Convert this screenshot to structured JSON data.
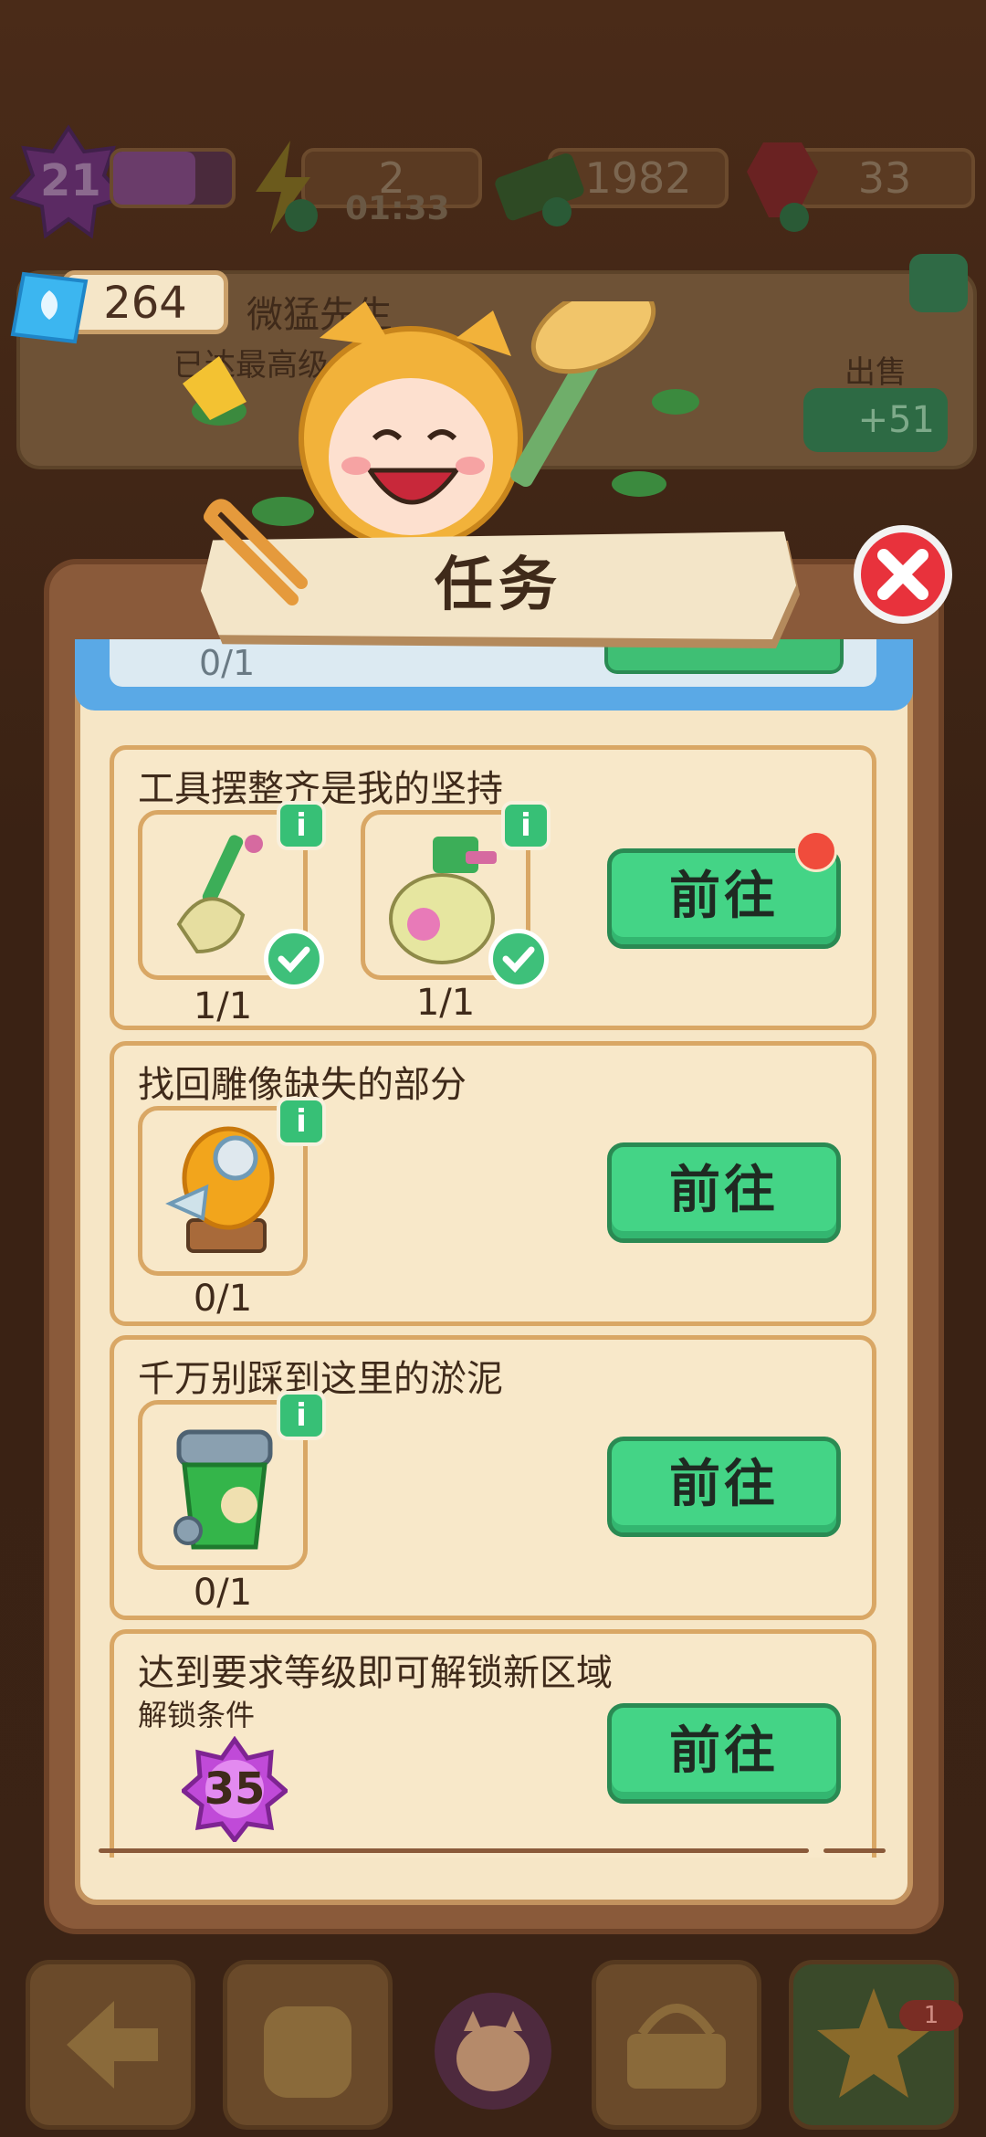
{
  "hud": {
    "level": "21",
    "energy": "2",
    "energy_timer": "01:33",
    "cash": "1982",
    "gems": "33",
    "tickets": "264"
  },
  "background_card": {
    "name": "微猛先生",
    "subtitle": "已达最高级，不",
    "sell_label": "出售",
    "sell_reward": "+51"
  },
  "dialog": {
    "title": "任务",
    "partial_task_count": "0/1",
    "tasks": [
      {
        "title": "工具摆整齐是我的坚持",
        "items": [
          {
            "name": "broom-icon",
            "count": "1/1",
            "done": true
          },
          {
            "name": "spray-bottle-icon",
            "count": "1/1",
            "done": true
          }
        ],
        "button": "前往",
        "has_notification": true
      },
      {
        "title": "找回雕像缺失的部分",
        "items": [
          {
            "name": "golden-statue-icon",
            "count": "0/1",
            "done": false
          }
        ],
        "button": "前往"
      },
      {
        "title": "千万别踩到这里的淤泥",
        "items": [
          {
            "name": "green-trash-bin-icon",
            "count": "0/1",
            "done": false
          }
        ],
        "button": "前往"
      },
      {
        "title": "达到要求等级即可解锁新区域",
        "unlock_label": "解锁条件",
        "required_level": "35",
        "button": "前往"
      }
    ]
  },
  "bottom_nav": {
    "badge_count": "1"
  },
  "colors": {
    "go_button": "#44d486",
    "card_bg": "#f8e8c9",
    "card_border": "#d9a765",
    "close_red": "#e8323c",
    "level_purple": "#c04ad8"
  }
}
